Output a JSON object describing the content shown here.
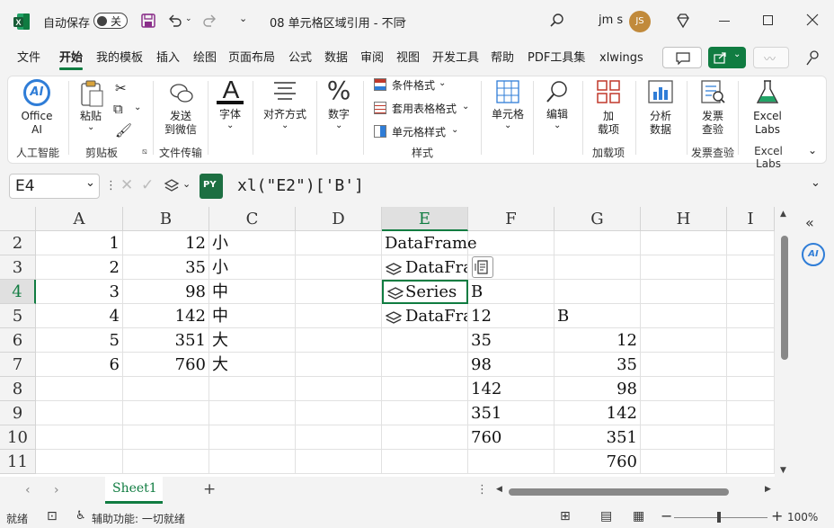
{
  "titlebar": {
    "autosave_label": "自动保存",
    "autosave_state": "关",
    "filename": "08 单元格区域引用 - 不同",
    "user": "jm s",
    "avatar_initials": "JS"
  },
  "menu": [
    "文件",
    "开始",
    "我的模板",
    "插入",
    "绘图",
    "页面布局",
    "公式",
    "数据",
    "审阅",
    "视图",
    "开发工具",
    "帮助",
    "PDF工具集",
    "xlwings"
  ],
  "menu_active": "开始",
  "ribbon": {
    "office_ai": [
      "Office",
      "AI"
    ],
    "group_ai": "人工智能",
    "paste": "粘贴",
    "group_clipboard": "剪贴板",
    "send_wechat": [
      "发送",
      "到微信"
    ],
    "group_filetransfer": "文件传输",
    "font": "字体",
    "align": "对齐方式",
    "number": "数字",
    "cond_format": "条件格式",
    "table_format": "套用表格格式",
    "cell_style": "单元格样式",
    "group_style": "样式",
    "cells": "单元格",
    "edit": "编辑",
    "addins": [
      "加",
      "载项"
    ],
    "group_addins": "加载项",
    "analyze": [
      "分析",
      "数据"
    ],
    "invoice": [
      "发票",
      "查验"
    ],
    "group_invoice": "发票查验",
    "excel_labs": [
      "Excel",
      "Labs"
    ],
    "group_labs": "Excel Labs"
  },
  "formula_bar": {
    "name_box": "E4",
    "py_badge": "PY",
    "formula": "xl(\"E2\")['B']"
  },
  "grid": {
    "columns": [
      "A",
      "B",
      "C",
      "D",
      "E",
      "F",
      "G",
      "H",
      "I"
    ],
    "rows": [
      "2",
      "3",
      "4",
      "5",
      "6",
      "7",
      "8",
      "9",
      "10",
      "11"
    ],
    "selected_col": "E",
    "selected_row": "4",
    "cells": {
      "A2": "1",
      "B2": "12",
      "C2": "小",
      "E2": "DataFrame",
      "A3": "2",
      "B3": "35",
      "C3": "小",
      "E3": "DataFrame",
      "A4": "3",
      "B4": "98",
      "C4": "中",
      "E4": "Series",
      "F4": "B",
      "A5": "4",
      "B5": "142",
      "C5": "中",
      "E5": "DataFrame",
      "F5": "12",
      "G5": "B",
      "A6": "5",
      "B6": "351",
      "C6": "大",
      "F6": "35",
      "G6": "12",
      "A7": "6",
      "B7": "760",
      "C7": "大",
      "F7": "98",
      "G7": "35",
      "F8": "142",
      "G8": "98",
      "F9": "351",
      "G9": "142",
      "F10": "760",
      "G10": "351",
      "G11": "760"
    }
  },
  "sheets": {
    "tabs": [
      "Sheet1"
    ],
    "active": "Sheet1"
  },
  "status": {
    "ready": "就绪",
    "accessibility": "辅助功能: 一切就绪",
    "zoom": "100%"
  },
  "colors": {
    "accent": "#107c41",
    "excel_green": "#1d6f42",
    "ai_blue": "#2f7dd7",
    "avatar": "#c18a3b"
  }
}
